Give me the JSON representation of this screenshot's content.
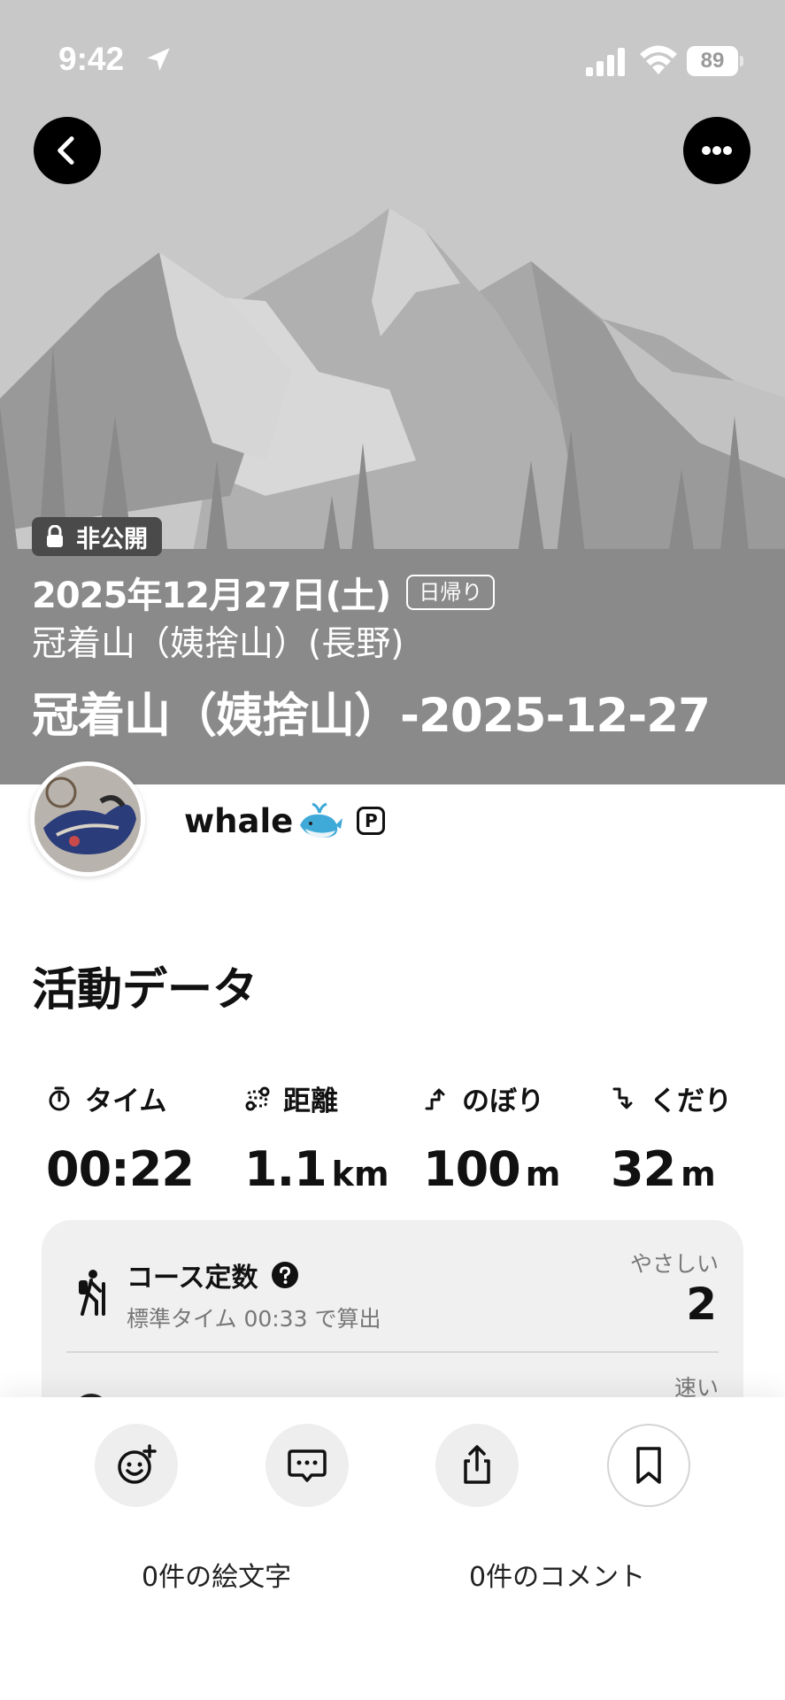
{
  "status_bar": {
    "time": "9:42",
    "battery": "89"
  },
  "hero": {
    "visibility_label": "非公開",
    "date": "2025年12月27日(土)",
    "trip_type": "日帰り",
    "location": "冠着山（姨捨山）(長野)",
    "title": "冠着山（姨捨山）-2025-12-27"
  },
  "user": {
    "name": "whale",
    "badge": "P"
  },
  "activity": {
    "section_title": "活動データ",
    "stats": [
      {
        "label": "タイム",
        "value": "00:22",
        "unit": "",
        "icon": "stopwatch-icon"
      },
      {
        "label": "距離",
        "value": "1.1",
        "unit": "km",
        "icon": "route-icon"
      },
      {
        "label": "のぼり",
        "value": "100",
        "unit": "m",
        "icon": "ascent-icon"
      },
      {
        "label": "くだり",
        "value": "32",
        "unit": "m",
        "icon": "descent-icon"
      }
    ],
    "course": {
      "title": "コース定数",
      "subtitle": "標準タイム 00:33 で算出",
      "level": "やさしい",
      "value": "2"
    },
    "speed_label": "速い"
  },
  "bottom": {
    "emoji_count": "0件の絵文字",
    "comment_count": "0件のコメント"
  },
  "colors": {
    "hero_bg": "#c8c8c8",
    "hero_overlay": "#8a8a8a",
    "card_bg": "#f0f0f0"
  }
}
